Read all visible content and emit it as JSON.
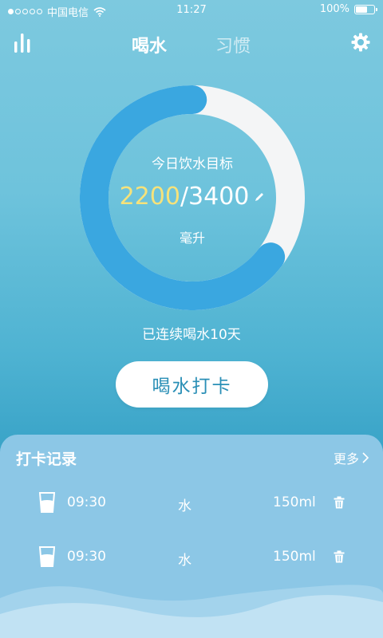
{
  "status_bar": {
    "carrier": "中国电信",
    "time": "11:27",
    "battery": "100%"
  },
  "nav": {
    "tabs": [
      {
        "label": "喝水",
        "active": true
      },
      {
        "label": "习惯",
        "active": false
      }
    ],
    "icons": [
      "bar-chart-icon",
      "gear-icon"
    ]
  },
  "goal": {
    "label": "今日饮水目标",
    "current": "2200",
    "separator": "/",
    "target": "3400",
    "unit": "毫升",
    "progress_fraction": 0.647
  },
  "streak_text": "已连续喝水10天",
  "checkin_button": "喝水打卡",
  "records": {
    "title": "打卡记录",
    "more": "更多",
    "rows": [
      {
        "time": "09:30",
        "kind": "水",
        "amount": "150ml"
      },
      {
        "time": "09:30",
        "kind": "水",
        "amount": "150ml"
      }
    ]
  },
  "colors": {
    "ring_progress": "#3aa7e0",
    "ring_track": "#f4f5f6",
    "current_value": "#f6e27a",
    "button_text": "#2a8fb6"
  }
}
